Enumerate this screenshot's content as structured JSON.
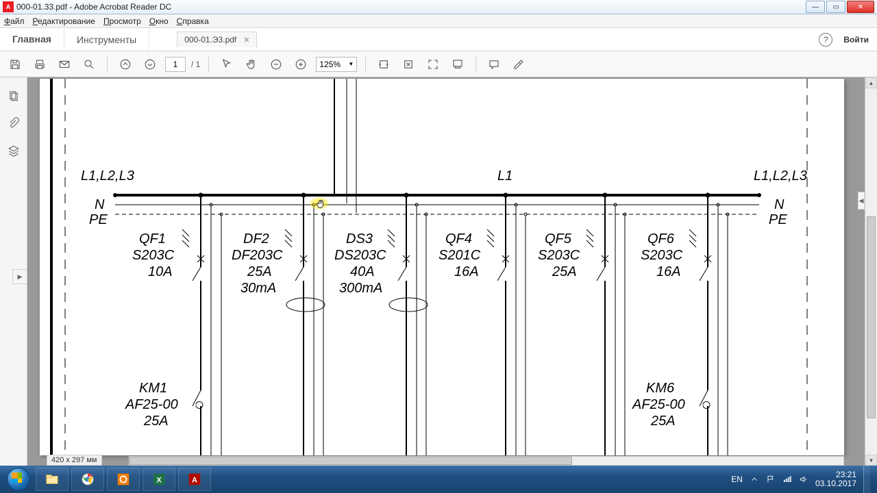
{
  "window": {
    "title": "000-01.33.pdf - Adobe Acrobat Reader DC"
  },
  "menu": {
    "file": "Файл",
    "edit": "Редактирование",
    "view": "Просмотр",
    "window": "Окно",
    "help": "Справка"
  },
  "bigtabs": {
    "home": "Главная",
    "tools": "Инструменты",
    "doc": "000-01.Э3.pdf",
    "signin": "Войти"
  },
  "toolbar": {
    "page_current": "1",
    "page_total": "/ 1",
    "zoom": "125%"
  },
  "diagram": {
    "busLeft": "L1,L2,L3",
    "busMid": "L1",
    "busRight": "L1,L2,L3",
    "N": "N",
    "PE": "PE",
    "breakers": [
      {
        "id": "QF1",
        "model": "S203C",
        "rating": "10A",
        "rcd": ""
      },
      {
        "id": "DF2",
        "model": "DF203C",
        "rating": "25A",
        "rcd": "30mA"
      },
      {
        "id": "DS3",
        "model": "DS203C",
        "rating": "40A",
        "rcd": "300mA"
      },
      {
        "id": "QF4",
        "model": "S201C",
        "rating": "16A",
        "rcd": ""
      },
      {
        "id": "QF5",
        "model": "S203C",
        "rating": "25A",
        "rcd": ""
      },
      {
        "id": "QF6",
        "model": "S203C",
        "rating": "16A",
        "rcd": ""
      }
    ],
    "contactors": [
      {
        "id": "KM1",
        "model": "AF25-00",
        "rating": "25A"
      },
      {
        "id": "KM6",
        "model": "AF25-00",
        "rating": "25A"
      }
    ]
  },
  "statusbar": {
    "pagesize": "420 x 297 мм"
  },
  "systray": {
    "lang": "EN",
    "time": "23:21",
    "date": "03.10.2017"
  }
}
